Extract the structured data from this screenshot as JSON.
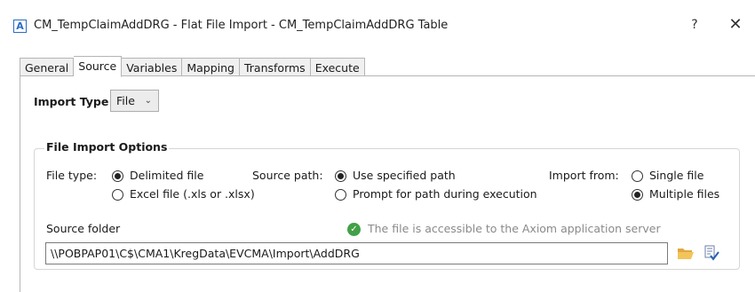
{
  "window": {
    "app_icon_letter": "A",
    "title": "CM_TempClaimAddDRG - Flat File Import - CM_TempClaimAddDRG Table",
    "help_label": "?",
    "close_label": "✕"
  },
  "tabs": [
    {
      "label": "General",
      "active": false
    },
    {
      "label": "Source",
      "active": true
    },
    {
      "label": "Variables",
      "active": false
    },
    {
      "label": "Mapping",
      "active": false
    },
    {
      "label": "Transforms",
      "active": false
    },
    {
      "label": "Execute",
      "active": false
    }
  ],
  "import_type": {
    "label": "Import Type",
    "value": "File"
  },
  "file_import_options": {
    "legend": "File Import Options",
    "file_type": {
      "label": "File type:",
      "options": [
        {
          "label": "Delimited file",
          "checked": true
        },
        {
          "label": "Excel file (.xls or .xlsx)",
          "checked": false
        }
      ]
    },
    "source_path": {
      "label": "Source path:",
      "options": [
        {
          "label": "Use specified path",
          "checked": true
        },
        {
          "label": "Prompt for path during execution",
          "checked": false
        }
      ]
    },
    "import_from": {
      "label": "Import from:",
      "options": [
        {
          "label": "Single file",
          "checked": false
        },
        {
          "label": "Multiple files",
          "checked": true
        }
      ]
    },
    "source_folder": {
      "label": "Source folder",
      "status_text": "The file is accessible to the Axiom application server",
      "status_color": "#43a047",
      "value": "\\\\POBPAP01\\C$\\CMA1\\KregData\\EVCMA\\Import\\AddDRG"
    }
  }
}
